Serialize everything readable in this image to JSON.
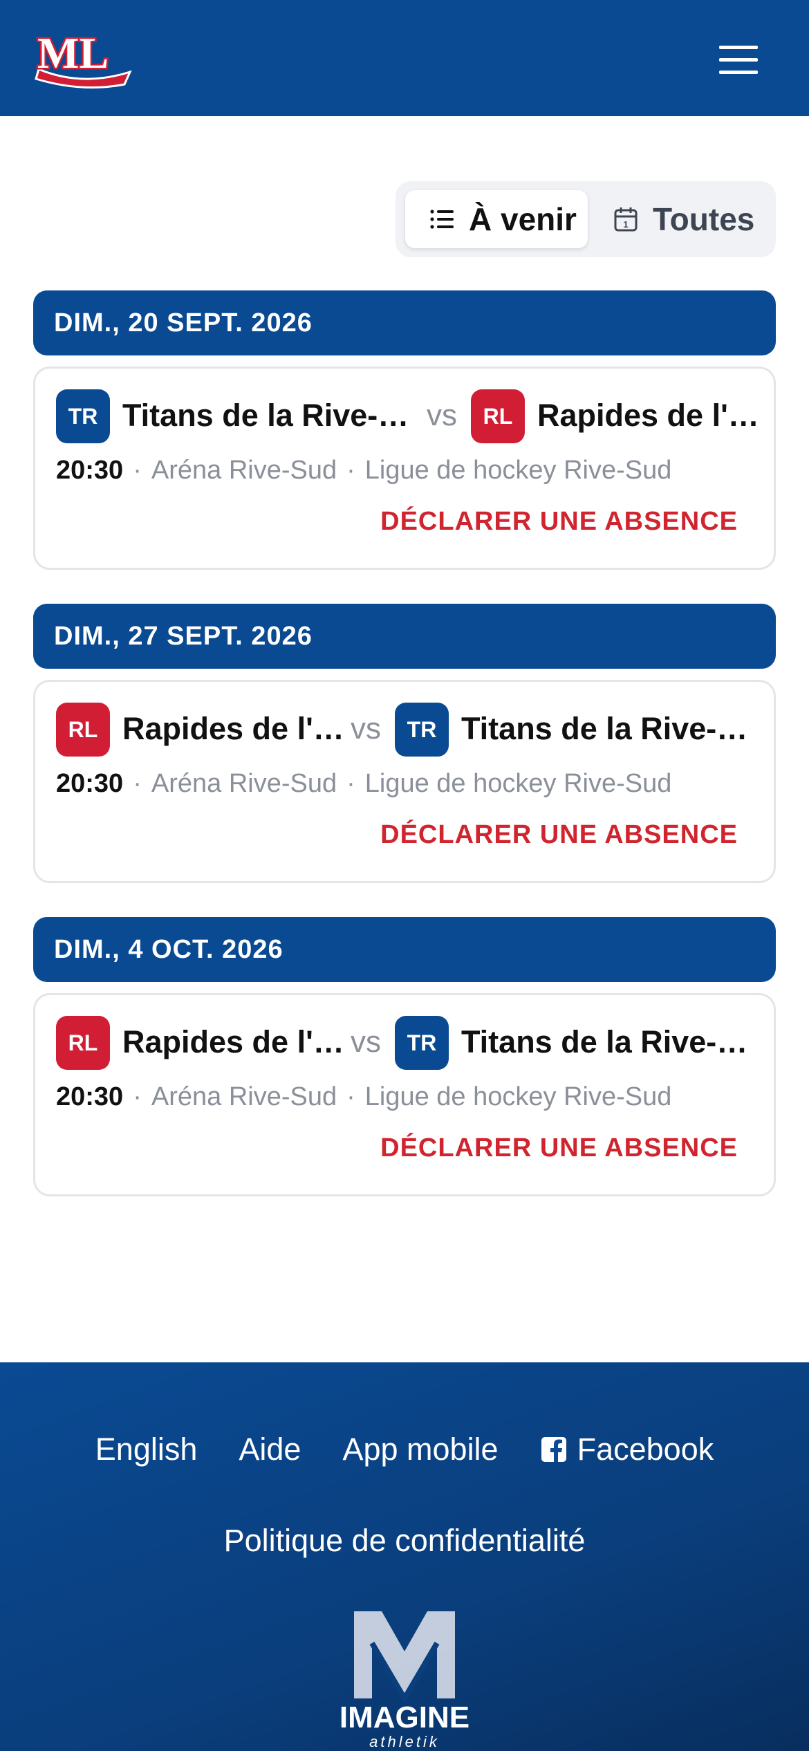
{
  "header": {
    "logo_text": "ML",
    "menu_label": "menu"
  },
  "filter": {
    "upcoming_label": "À venir",
    "all_label": "Toutes"
  },
  "games": [
    {
      "date": "DIM., 20 SEPT. 2026",
      "home": {
        "abbr": "TR",
        "name": "Titans de la Rive-…",
        "color": "#0a4a93"
      },
      "vs": "vs",
      "away": {
        "abbr": "RL",
        "name": "Rapides de l'…",
        "color": "#d21e34"
      },
      "time": "20:30",
      "venue": "Aréna Rive-Sud",
      "league": "Ligue de hockey Rive-Sud",
      "action": "DÉCLARER UNE ABSENCE"
    },
    {
      "date": "DIM., 27 SEPT. 2026",
      "home": {
        "abbr": "RL",
        "name": "Rapides de l'…",
        "color": "#d21e34"
      },
      "vs": "vs",
      "away": {
        "abbr": "TR",
        "name": "Titans de la Rive-…",
        "color": "#0a4a93"
      },
      "time": "20:30",
      "venue": "Aréna Rive-Sud",
      "league": "Ligue de hockey Rive-Sud",
      "action": "DÉCLARER UNE ABSENCE"
    },
    {
      "date": "DIM., 4 OCT. 2026",
      "home": {
        "abbr": "RL",
        "name": "Rapides de l'…",
        "color": "#d21e34"
      },
      "vs": "vs",
      "away": {
        "abbr": "TR",
        "name": "Titans de la Rive-…",
        "color": "#0a4a93"
      },
      "time": "20:30",
      "venue": "Aréna Rive-Sud",
      "league": "Ligue de hockey Rive-Sud",
      "action": "DÉCLARER UNE ABSENCE"
    }
  ],
  "footer": {
    "links": {
      "english": "English",
      "help": "Aide",
      "mobile": "App mobile",
      "facebook": "Facebook"
    },
    "privacy": "Politique de confidentialité",
    "brand": {
      "name": "IMAGINE",
      "tagline": "athletik"
    }
  },
  "colors": {
    "primary": "#0a4a93",
    "accent_red": "#d21e34",
    "action_red": "#d0252f"
  }
}
